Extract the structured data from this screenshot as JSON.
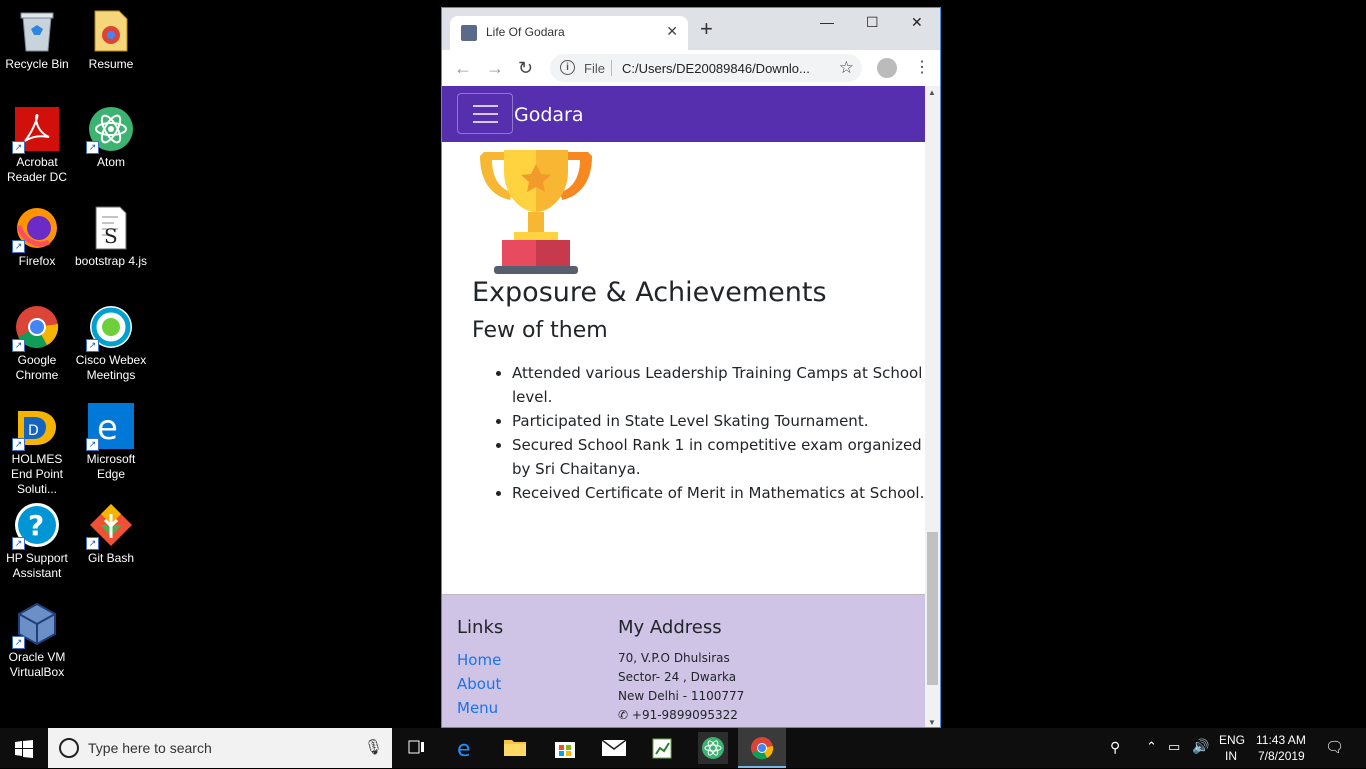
{
  "desktop_icons": [
    {
      "label": "Recycle Bin",
      "icon": "recycle-bin-icon"
    },
    {
      "label": "Resume",
      "icon": "document-icon"
    },
    {
      "label": "Acrobat Reader DC",
      "icon": "acrobat-icon"
    },
    {
      "label": "Atom",
      "icon": "atom-icon"
    },
    {
      "label": "Firefox",
      "icon": "firefox-icon"
    },
    {
      "label": "bootstrap 4.js",
      "icon": "script-file-icon"
    },
    {
      "label": "Google Chrome",
      "icon": "chrome-icon"
    },
    {
      "label": "Cisco Webex Meetings",
      "icon": "webex-icon"
    },
    {
      "label": "HOLMES End Point Soluti...",
      "icon": "holmes-icon"
    },
    {
      "label": "Microsoft Edge",
      "icon": "edge-icon"
    },
    {
      "label": "HP Support Assistant",
      "icon": "help-icon"
    },
    {
      "label": "Git Bash",
      "icon": "git-icon"
    },
    {
      "label": "Oracle VM VirtualBox",
      "icon": "virtualbox-icon"
    }
  ],
  "browser": {
    "tab_title": "Life Of Godara",
    "new_tab": "+",
    "address_scheme": "File",
    "address_url": "C:/Users/DE20089846/Downlo...",
    "colors": {
      "navbar": "#552fad",
      "footer": "#cfc4e6",
      "link": "#1a73e8"
    }
  },
  "page": {
    "brand": "Godara",
    "heading": "Exposure & Achievements",
    "subheading": "Few of them",
    "achievements": [
      "Attended various Leadership Training Camps at School level.",
      "Participated in State Level Skating Tournament.",
      "Secured School Rank 1 in competitive exam organized by Sri Chaitanya.",
      "Received Certificate of Merit in Mathematics at School."
    ],
    "footer": {
      "links_heading": "Links",
      "links": [
        "Home",
        "About",
        "Menu"
      ],
      "address_heading": "My Address",
      "address_lines": [
        "70, V.P.O Dhulsiras",
        "Sector- 24 , Dwarka",
        "New Delhi - 1100777"
      ],
      "phone": "+91-9899095322"
    }
  },
  "taskbar": {
    "search_placeholder": "Type here to search",
    "language": "ENG",
    "region": "IN",
    "time": "11:43 AM",
    "date": "7/8/2019"
  }
}
